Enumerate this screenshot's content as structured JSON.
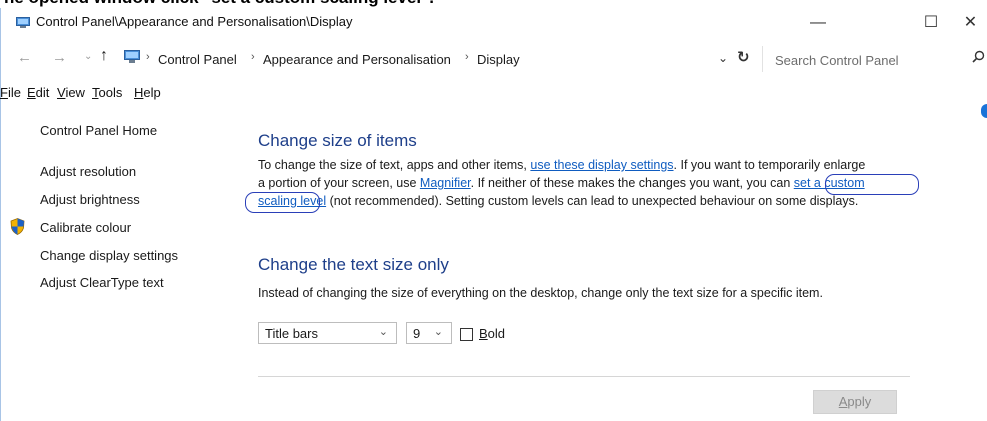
{
  "caption": "he opened window click \"set a custom scaling level\".",
  "window": {
    "title": "Control Panel\\Appearance and Personalisation\\Display",
    "minimize": "—",
    "maximize": "☐",
    "close": "✕"
  },
  "address": {
    "breadcrumb": [
      "Control Panel",
      "Appearance and Personalisation",
      "Display"
    ],
    "separator": "›",
    "search_placeholder": "Search Control Panel"
  },
  "menu": [
    {
      "key": "F",
      "rest": "ile"
    },
    {
      "key": "E",
      "rest": "dit"
    },
    {
      "key": "V",
      "rest": "iew"
    },
    {
      "key": "T",
      "rest": "ools"
    },
    {
      "key": "H",
      "rest": "elp"
    }
  ],
  "sidebar": {
    "home": "Control Panel Home",
    "links": [
      "Adjust resolution",
      "Adjust brightness",
      "Calibrate colour",
      "Change display settings",
      "Adjust ClearType text"
    ]
  },
  "section1": {
    "heading": "Change size of items",
    "line1_a": "To change the size of text, apps and other items, ",
    "line1_link": "use these display settings",
    "line1_b": ". If you want to temporarily enlarge",
    "line2_a": "a portion of your screen, use ",
    "line2_link": "Magnifier",
    "line2_b": ". If neither of these makes the changes you want, you can ",
    "line2_link2": "set a custom",
    "line3_link": "scaling level",
    "line3_b": " (not recommended). Setting custom levels can lead to unexpected behaviour on some displays."
  },
  "section2": {
    "heading": "Change the text size only",
    "description": "Instead of changing the size of everything on the desktop, change only the text size for a specific item.",
    "item_select": "Title bars",
    "size_select": "9",
    "bold_key": "B",
    "bold_rest": "old",
    "bold_checked": false
  },
  "apply_key": "A",
  "apply_rest": "pply",
  "colors": {
    "heading": "#1e3f8a",
    "link": "#0f5cc0",
    "annotation": "#2a3fb8"
  }
}
